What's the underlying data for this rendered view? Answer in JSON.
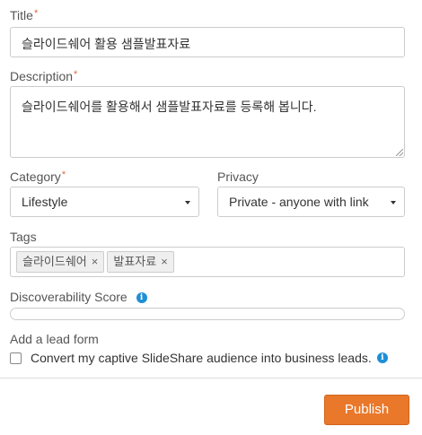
{
  "form": {
    "title_label": "Title",
    "title_value": "슬라이드쉐어 활용 샘플발표자료",
    "required_mark": "*",
    "description_label": "Description",
    "description_value": "슬라이드쉐어를 활용해서 샘플발표자료를 등록해 봅니다.",
    "category_label": "Category",
    "category_value": "Lifestyle",
    "privacy_label": "Privacy",
    "privacy_value": "Private - anyone with link",
    "tags_label": "Tags",
    "tags": [
      {
        "label": "슬라이드쉐어",
        "remove": "×"
      },
      {
        "label": "발표자료",
        "remove": "×"
      }
    ],
    "discoverability_label": "Discoverability Score",
    "discoverability_score": 0,
    "info_glyph": "i",
    "lead_form_label": "Add a lead form",
    "lead_form_checkbox_label": "Convert my captive SlideShare audience into business leads.",
    "lead_form_checked": false
  },
  "footer": {
    "publish_label": "Publish"
  },
  "colors": {
    "accent": "#e9782b",
    "info": "#1e8fd6",
    "required": "#e0683a"
  }
}
